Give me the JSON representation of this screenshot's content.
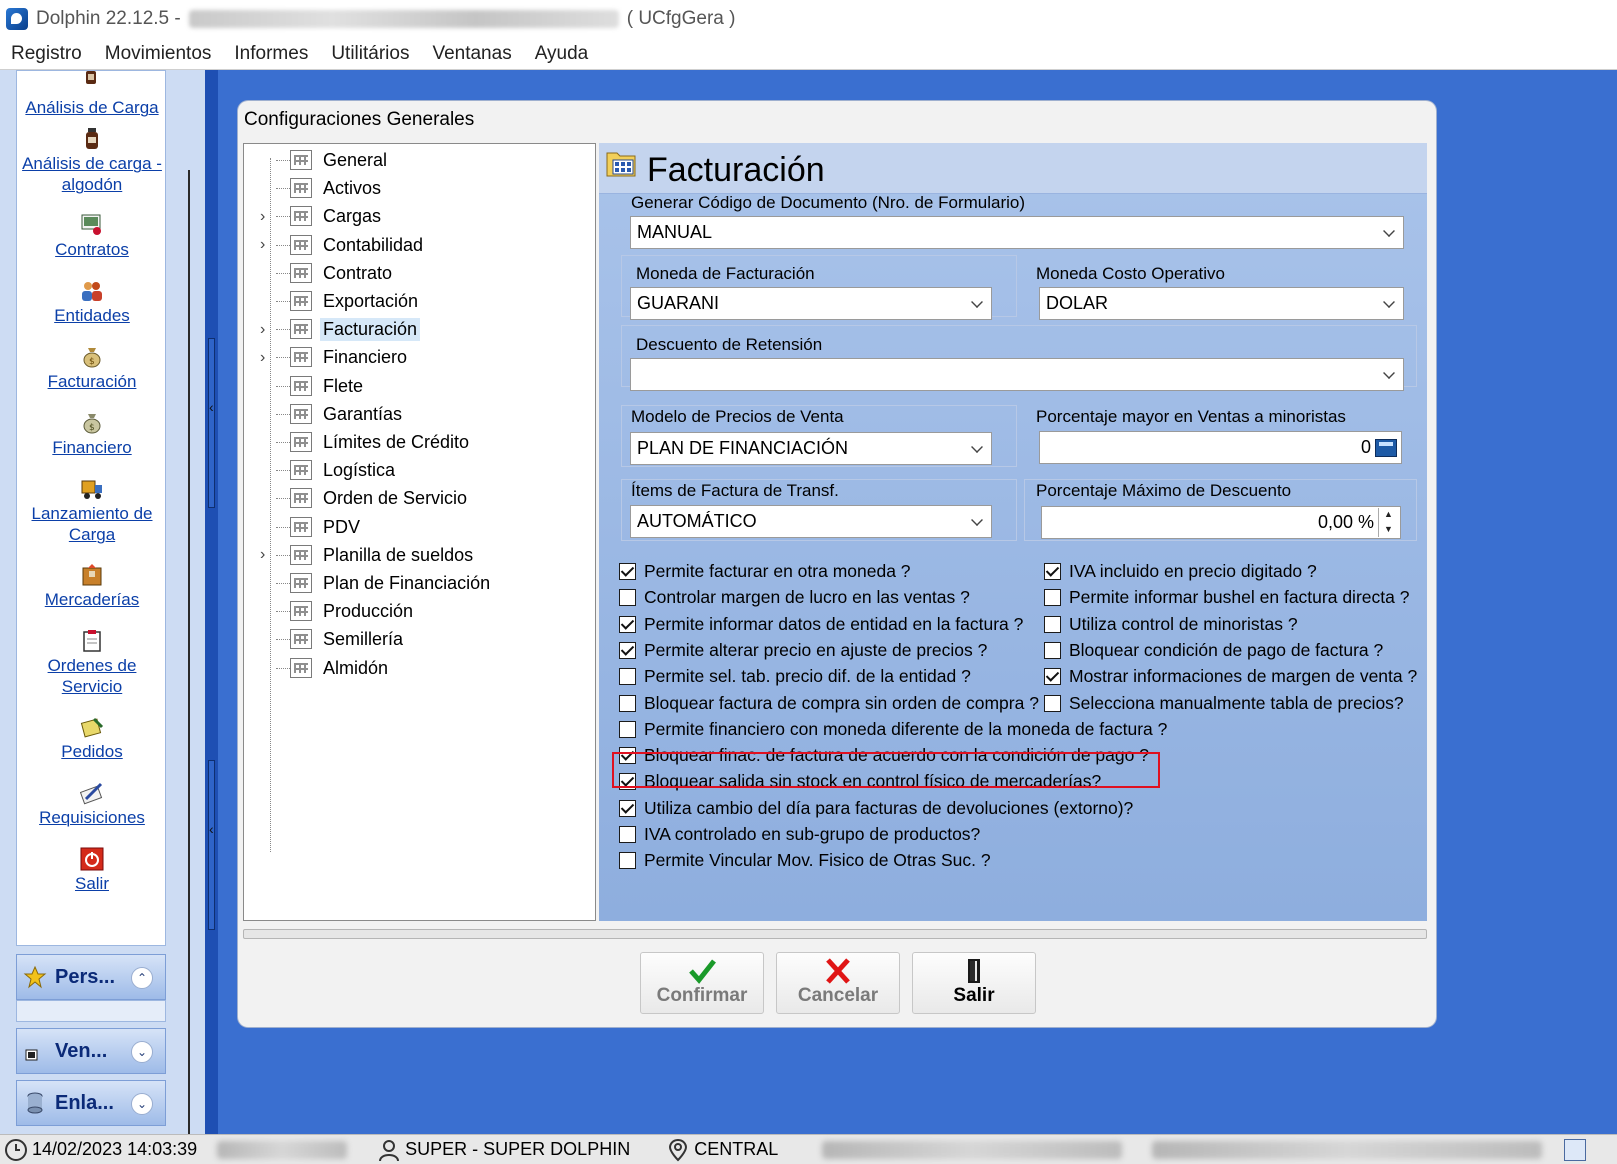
{
  "window": {
    "title_prefix": "Dolphin 22.12.5 -",
    "title_suffix": "( UCfgGera )"
  },
  "menu": [
    "Registro",
    "Movimientos",
    "Informes",
    "Utilitários",
    "Ventanas",
    "Ayuda"
  ],
  "nav": {
    "items": [
      {
        "label": "Análisis de Carga",
        "icon": "sample-bottle-icon"
      },
      {
        "label": "Análisis de carga -\nalgodón",
        "icon": "sample-bottle-icon"
      },
      {
        "label": "Contratos",
        "icon": "contract-icon"
      },
      {
        "label": "Entidades",
        "icon": "people-icon"
      },
      {
        "label": "Facturación",
        "icon": "money-bag-icon"
      },
      {
        "label": "Financiero",
        "icon": "money-bag-icon"
      },
      {
        "label": "Lanzamiento de\nCarga",
        "icon": "truck-icon"
      },
      {
        "label": "Mercaderías",
        "icon": "package-icon"
      },
      {
        "label": "Ordenes de\nServicio",
        "icon": "clipboard-icon"
      },
      {
        "label": "Pedidos",
        "icon": "order-icon"
      },
      {
        "label": "Requisiciones",
        "icon": "pen-paper-icon"
      },
      {
        "label": "Salir",
        "icon": "power-icon"
      }
    ],
    "groups": [
      {
        "label": "Pers...",
        "icon": "star-icon"
      },
      {
        "label": "Ven...",
        "icon": "window-icon"
      },
      {
        "label": "Enla...",
        "icon": "database-icon"
      }
    ]
  },
  "dialog": {
    "title": "Configuraciones Generales",
    "tree": [
      {
        "label": "General",
        "expandable": false
      },
      {
        "label": "Activos",
        "expandable": false
      },
      {
        "label": "Cargas",
        "expandable": true
      },
      {
        "label": "Contabilidad",
        "expandable": true
      },
      {
        "label": "Contrato",
        "expandable": false
      },
      {
        "label": "Exportación",
        "expandable": false
      },
      {
        "label": "Facturación",
        "expandable": true,
        "selected": true
      },
      {
        "label": "Financiero",
        "expandable": true
      },
      {
        "label": "Flete",
        "expandable": false
      },
      {
        "label": "Garantías",
        "expandable": false
      },
      {
        "label": "Límites de Crédito",
        "expandable": false
      },
      {
        "label": "Logística",
        "expandable": false
      },
      {
        "label": "Orden de Servicio",
        "expandable": false
      },
      {
        "label": "PDV",
        "expandable": false
      },
      {
        "label": "Planilla de sueldos",
        "expandable": true
      },
      {
        "label": "Plan de Financiación",
        "expandable": false
      },
      {
        "label": "Producción",
        "expandable": false
      },
      {
        "label": "Semillería",
        "expandable": false
      },
      {
        "label": "Almidón",
        "expandable": false
      }
    ],
    "panel": {
      "title": "Facturación",
      "fields": {
        "codigo_doc": {
          "label": "Generar Código de Documento (Nro. de Formulario)",
          "value": "MANUAL"
        },
        "moneda_fact": {
          "label": "Moneda de Facturación",
          "value": "GUARANI"
        },
        "moneda_costo": {
          "label": "Moneda Costo Operativo",
          "value": "DOLAR"
        },
        "descuento_ret": {
          "label": "Descuento de Retensión",
          "value": ""
        },
        "modelo_precios": {
          "label": "Modelo de Precios de Venta",
          "value": "PLAN DE FINANCIACIÓN"
        },
        "porc_mayor": {
          "label": "Porcentaje mayor en Ventas a minoristas",
          "value": "0"
        },
        "items_factura": {
          "label": "Ítems de Factura de Transf.",
          "value": "AUTOMÁTICO"
        },
        "porc_max_desc": {
          "label": "Porcentaje Máximo de Descuento",
          "value": "0,00 %"
        }
      },
      "checks_left": [
        {
          "label": "Permite facturar en otra moneda ?",
          "checked": true
        },
        {
          "label": "Controlar margen de lucro en las ventas ?",
          "checked": false
        },
        {
          "label": "Permite  informar datos de entidad en la factura ?",
          "checked": true
        },
        {
          "label": "Permite alterar precio en ajuste de precios ?",
          "checked": true
        },
        {
          "label": "Permite sel. tab. precio dif. de la entidad ?",
          "checked": false
        },
        {
          "label": "Bloquear factura de compra sin orden de compra ?",
          "checked": false
        },
        {
          "label": "Permite financiero con moneda diferente de la moneda de factura ?",
          "checked": false
        },
        {
          "label": "Bloquear finac. de factura de acuerdo con la condición de pago ?",
          "checked": true
        },
        {
          "label": "Bloquear salida sin stock en control físico de mercaderías?",
          "checked": true
        },
        {
          "label": "Utiliza cambio del día para facturas de devoluciones (extorno)?",
          "checked": true
        },
        {
          "label": "IVA controlado en sub-grupo de productos?",
          "checked": false
        },
        {
          "label": "Permite Vincular Mov. Fisico de Otras Suc. ?",
          "checked": false
        }
      ],
      "checks_right": [
        {
          "label": "IVA incluido en precio digitado ?",
          "checked": true
        },
        {
          "label": "Permite informar bushel en factura directa ?",
          "checked": false
        },
        {
          "label": "Utiliza control de minoristas ?",
          "checked": false
        },
        {
          "label": "Bloquear condición de pago de factura ?",
          "checked": false
        },
        {
          "label": "Mostrar informaciones de margen de venta ?",
          "checked": true
        },
        {
          "label": "Selecciona manualmente tabla de precios?",
          "checked": false
        }
      ]
    },
    "buttons": {
      "confirm": "Confirmar",
      "cancel": "Cancelar",
      "exit": "Salir"
    }
  },
  "status": {
    "datetime": "14/02/2023 14:03:39",
    "user": "SUPER - SUPER DOLPHIN",
    "branch": "CENTRAL"
  },
  "colors": {
    "desktop": "#3a6fd0",
    "highlight_border": "#e01020",
    "confirm_check": "#1a9a2a",
    "cancel_x": "#e01515"
  }
}
